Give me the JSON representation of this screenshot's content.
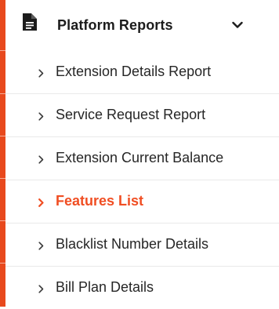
{
  "colors": {
    "accent": "#e8491d",
    "active_text": "#f04e23",
    "text": "#262626",
    "divider": "#e9e9e9"
  },
  "menu": {
    "header": {
      "icon": "document-icon",
      "label": "Platform Reports",
      "toggle_icon": "chevron-down-icon",
      "expanded": true
    },
    "items": [
      {
        "label": "Extension Details Report",
        "icon": "chevron-right-icon",
        "active": false
      },
      {
        "label": "Service Request Report",
        "icon": "chevron-right-icon",
        "active": false
      },
      {
        "label": "Extension Current Balance",
        "icon": "chevron-right-icon",
        "active": false
      },
      {
        "label": "Features List",
        "icon": "chevron-right-icon",
        "active": true
      },
      {
        "label": "Blacklist Number Details",
        "icon": "chevron-right-icon",
        "active": false
      },
      {
        "label": "Bill Plan Details",
        "icon": "chevron-right-icon",
        "active": false
      }
    ]
  }
}
